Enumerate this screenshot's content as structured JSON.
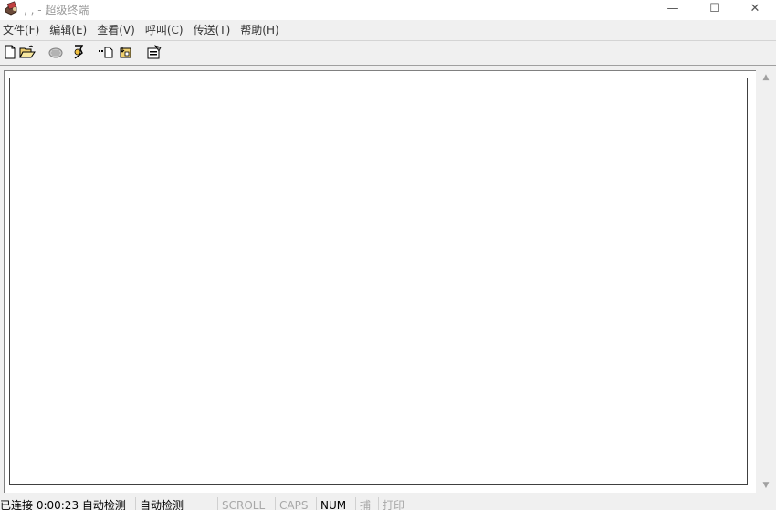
{
  "window": {
    "title": ",  ,   - 超级终端",
    "controls": {
      "minimize": "—",
      "maximize": "☐",
      "close": "✕"
    }
  },
  "menu": {
    "items": [
      {
        "label": "文件(F)"
      },
      {
        "label": "编辑(E)"
      },
      {
        "label": "查看(V)"
      },
      {
        "label": "呼叫(C)"
      },
      {
        "label": "传送(T)"
      },
      {
        "label": "帮助(H)"
      }
    ]
  },
  "toolbar": {
    "buttons": [
      {
        "icon": "new-icon"
      },
      {
        "icon": "open-icon"
      },
      {
        "icon": "phone-icon"
      },
      {
        "icon": "disconnect-icon"
      },
      {
        "icon": "send-file-icon"
      },
      {
        "icon": "receive-file-icon"
      },
      {
        "icon": "properties-icon"
      }
    ]
  },
  "scrollbar": {
    "up": "▲",
    "down": "▼"
  },
  "statusbar": {
    "connection": "已连接 0:00:23",
    "detect1": "自动检测",
    "detect2": "自动检测",
    "scroll": "SCROLL",
    "caps": "CAPS",
    "num": "NUM",
    "capture": "捕",
    "print": "打印"
  }
}
